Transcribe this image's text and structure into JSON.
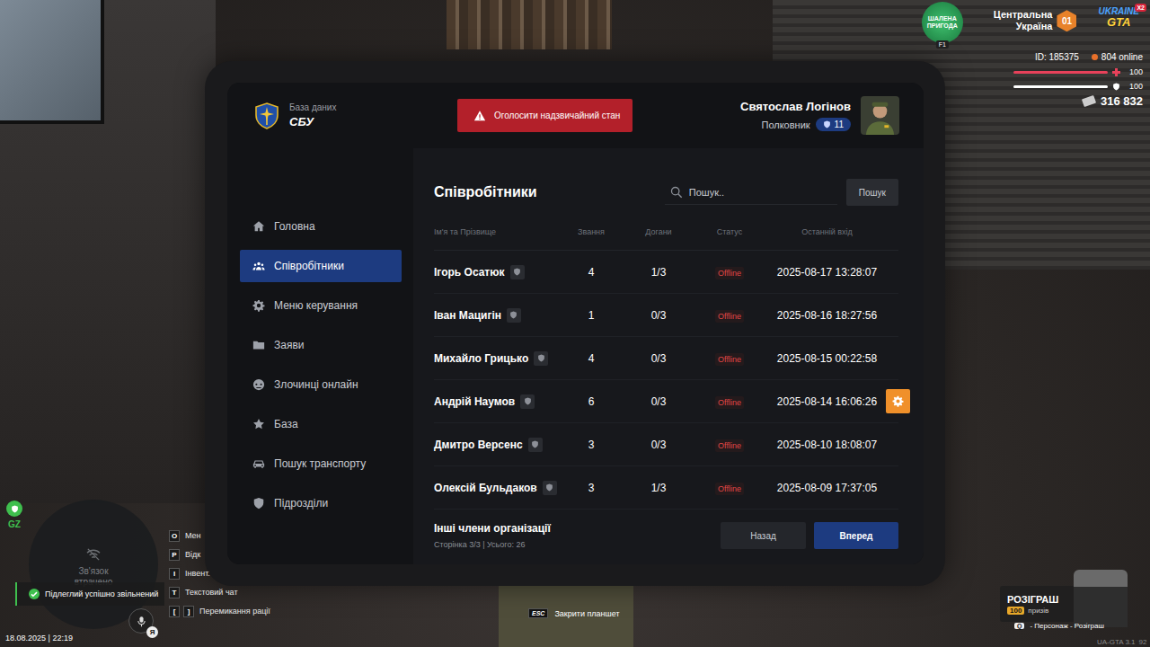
{
  "hud": {
    "event_logo": {
      "line1": "ШАЛЕНА",
      "line2": "ПРИГОДА",
      "key": "F1"
    },
    "region": {
      "line1": "Центральна",
      "line2": "Україна",
      "badge": "01"
    },
    "server_logo": {
      "line1": "UKRAINE",
      "line2": "GTA",
      "multiplier": "X2"
    },
    "player_id": "ID: 185375",
    "online": "804 online",
    "health": {
      "value": "100",
      "level": 1
    },
    "armor": {
      "value": "100",
      "level": 1
    },
    "money": "316 832"
  },
  "tablet": {
    "brand": {
      "subtitle": "База даних",
      "title": "СБУ"
    },
    "emergency_button": "Оголосити надзвичайний стан",
    "user": {
      "name": "Святослав Логінов",
      "rank": "Полковник",
      "level": "11"
    },
    "sidebar": [
      {
        "label": "Головна",
        "selected": false
      },
      {
        "label": "Співробітники",
        "selected": true
      },
      {
        "label": "Меню керування",
        "selected": false
      },
      {
        "label": "Заяви",
        "selected": false
      },
      {
        "label": "Злочинці онлайн",
        "selected": false
      },
      {
        "label": "База",
        "selected": false
      },
      {
        "label": "Пошук транспорту",
        "selected": false
      },
      {
        "label": "Підрозділи",
        "selected": false
      }
    ],
    "page_title": "Співробітники",
    "search": {
      "placeholder": "Пошук..",
      "button": "Пошук"
    },
    "table": {
      "columns": [
        "Ім'я та Прізвище",
        "Звання",
        "Догани",
        "Статус",
        "Останній вхід"
      ],
      "rows": [
        {
          "name": "Ігорь Осатюк",
          "rank": "4",
          "reprimands": "1/3",
          "status": "Offline",
          "last_login": "2025-08-17 13:28:07",
          "hovered": false
        },
        {
          "name": "Іван Мацигін",
          "rank": "1",
          "reprimands": "0/3",
          "status": "Offline",
          "last_login": "2025-08-16 18:27:56",
          "hovered": false
        },
        {
          "name": "Михайло Грицько",
          "rank": "4",
          "reprimands": "0/3",
          "status": "Offline",
          "last_login": "2025-08-15 00:22:58",
          "hovered": false
        },
        {
          "name": "Андрій Наумов",
          "rank": "6",
          "reprimands": "0/3",
          "status": "Offline",
          "last_login": "2025-08-14 16:06:26",
          "hovered": true
        },
        {
          "name": "Дмитро Версенс",
          "rank": "3",
          "reprimands": "0/3",
          "status": "Offline",
          "last_login": "2025-08-10 18:08:07",
          "hovered": false
        },
        {
          "name": "Олексій Бульдаков",
          "rank": "3",
          "reprimands": "1/3",
          "status": "Offline",
          "last_login": "2025-08-09 17:37:05",
          "hovered": false
        }
      ]
    },
    "footer": {
      "title": "Інші члени організації",
      "page_info": "Сторінка 3/3 | Усього: 26",
      "prev": "Назад",
      "next": "Вперед"
    }
  },
  "minimap": {
    "line1": "Зв'язок",
    "line2": "втрачено",
    "zone": "GZ"
  },
  "notification": "Підлеглий успішно звільнений",
  "keys": [
    {
      "keys": [
        "O"
      ],
      "label": "Мен"
    },
    {
      "keys": [
        "P"
      ],
      "label": "Відк"
    },
    {
      "keys": [
        "I"
      ],
      "label": "Інвент."
    },
    {
      "keys": [
        "T"
      ],
      "label": "Текстовий чат"
    },
    {
      "keys": [
        "[",
        "]"
      ],
      "label": "Перемикання рації"
    }
  ],
  "mic_badge": "Я",
  "datetime": "18.08.2025 | 22:19",
  "close_hint": {
    "key": "ESC",
    "label": "Закрити планшет"
  },
  "giveaway": {
    "title": "РОЗІГРАШ",
    "count": "100",
    "count_label": "призів",
    "key": "Q",
    "action": "- Персонаж - Розіграш"
  },
  "version": "UA-GTA 3.1",
  "fps": "92"
}
